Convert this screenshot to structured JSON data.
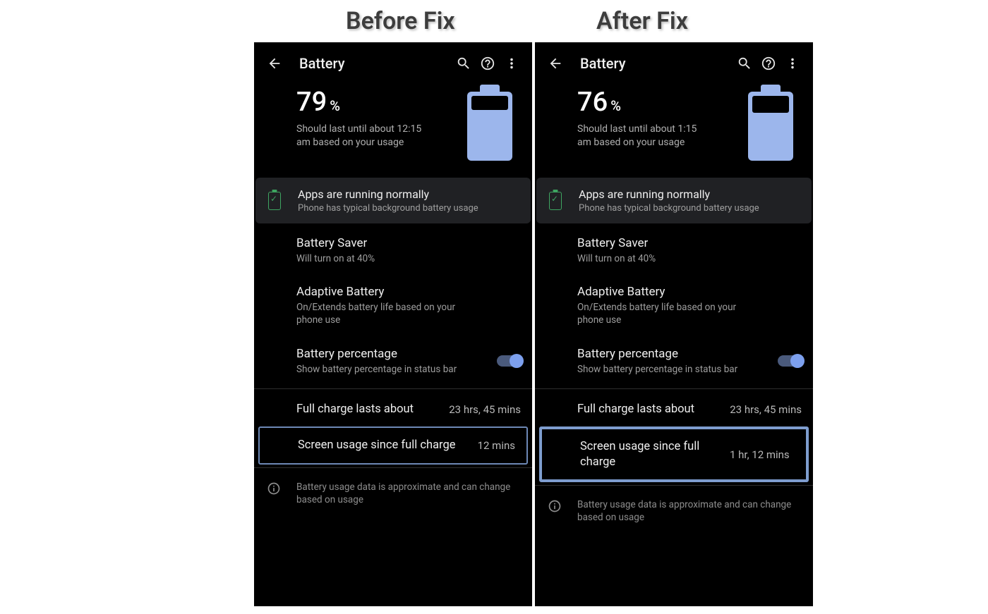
{
  "headings": {
    "before": "Before Fix",
    "after": "After Fix"
  },
  "screens": {
    "before": {
      "appbar": {
        "title": "Battery"
      },
      "hero": {
        "pct": "79",
        "unit": "%",
        "estimate": "Should last until about 12:15 am based on your usage",
        "drain_height": 20
      },
      "status_card": {
        "title": "Apps are running normally",
        "sub": "Phone has typical background battery usage"
      },
      "rows": {
        "saver": {
          "title": "Battery Saver",
          "sub": "Will turn on at 40%"
        },
        "adaptive": {
          "title": "Adaptive Battery",
          "sub": "On/Extends battery life based on your phone use"
        },
        "percentage": {
          "title": "Battery percentage",
          "sub": "Show battery percentage in status bar"
        }
      },
      "stats": {
        "full_charge": {
          "label": "Full charge lasts about",
          "val": "23 hrs, 45 mins"
        },
        "screen_usage": {
          "label": "Screen usage since full charge",
          "val": "12 mins"
        }
      },
      "info": "Battery usage data is approximate and can change based on usage"
    },
    "after": {
      "appbar": {
        "title": "Battery"
      },
      "hero": {
        "pct": "76",
        "unit": "%",
        "estimate": "Should last until about 1:15 am based on your usage",
        "drain_height": 24
      },
      "status_card": {
        "title": "Apps are running normally",
        "sub": "Phone has typical background battery usage"
      },
      "rows": {
        "saver": {
          "title": "Battery Saver",
          "sub": "Will turn on at 40%"
        },
        "adaptive": {
          "title": "Adaptive Battery",
          "sub": "On/Extends battery life based on your phone use"
        },
        "percentage": {
          "title": "Battery percentage",
          "sub": "Show battery percentage in status bar"
        }
      },
      "stats": {
        "full_charge": {
          "label": "Full charge lasts about",
          "val": "23 hrs, 45 mins"
        },
        "screen_usage": {
          "label": "Screen usage since full charge",
          "val": "1 hr, 12 mins"
        }
      },
      "info": "Battery usage data is approximate and can change based on usage"
    }
  }
}
